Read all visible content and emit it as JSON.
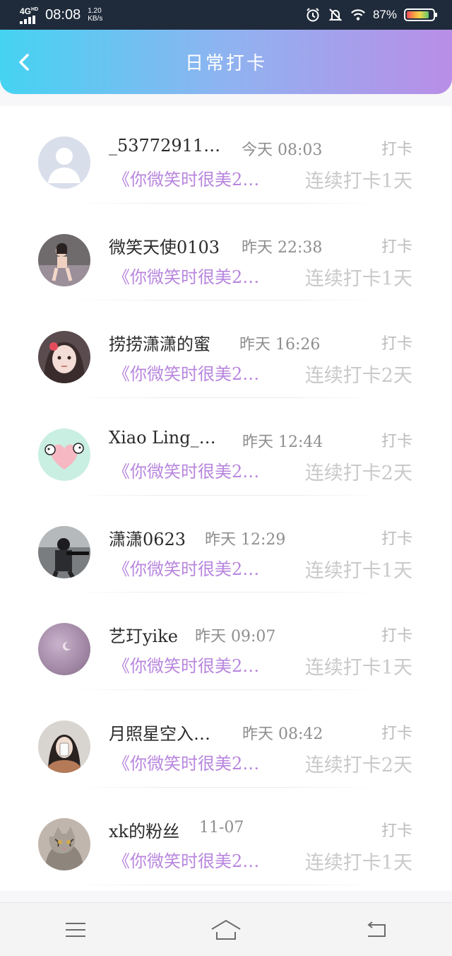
{
  "status_bar": {
    "network": "4G",
    "network_sup": "HD",
    "time": "08:08",
    "speed_value": "1.20",
    "speed_unit": "KB/s",
    "battery_percent": "87%",
    "battery_level": 0.87,
    "icons": [
      "alarm-icon",
      "mute-bell-icon",
      "wifi-icon",
      "battery-icon"
    ]
  },
  "header": {
    "title": "日常打卡",
    "back_icon": "chevron-left-icon",
    "gradient": [
      "#45d3f2",
      "#8fb3f0",
      "#b98ee6"
    ]
  },
  "colors": {
    "book_text": "#b886de",
    "streak_text": "#c9c9c9",
    "tag_text": "#bcbcbc"
  },
  "records": [
    {
      "name": "_53772911…",
      "time": "今天 08:03",
      "tag": "打卡",
      "book": "《你微笑时很美2…",
      "streak": "连续打卡1天",
      "avatar": "default-avatar"
    },
    {
      "name": "微笑天使0103",
      "time": "昨天 22:38",
      "tag": "打卡",
      "book": "《你微笑时很美2…",
      "streak": "连续打卡1天",
      "avatar": "photo-avatar"
    },
    {
      "name": "捞捞潇潇的蜜",
      "time": "昨天 16:26",
      "tag": "打卡",
      "book": "《你微笑时很美2…",
      "streak": "连续打卡2天",
      "avatar": "photo-avatar"
    },
    {
      "name": "Xiao Ling_…",
      "time": "昨天 12:44",
      "tag": "打卡",
      "book": "《你微笑时很美2…",
      "streak": "连续打卡2天",
      "avatar": "panda-heart-avatar"
    },
    {
      "name": "潇潇0623",
      "time": "昨天 12:29",
      "tag": "打卡",
      "book": "《你微笑时很美2…",
      "streak": "连续打卡1天",
      "avatar": "photo-avatar"
    },
    {
      "name": "艺玎yike",
      "time": "昨天 09:07",
      "tag": "打卡",
      "book": "《你微笑时很美2…",
      "streak": "连续打卡1天",
      "avatar": "photo-avatar"
    },
    {
      "name": "月照星空入…",
      "time": "昨天 08:42",
      "tag": "打卡",
      "book": "《你微笑时很美2…",
      "streak": "连续打卡2天",
      "avatar": "photo-avatar"
    },
    {
      "name": "xk的粉丝",
      "time": "11-07",
      "tag": "打卡",
      "book": "《你微笑时很美2…",
      "streak": "连续打卡1天",
      "avatar": "cat-avatar"
    }
  ],
  "nav_bar": {
    "buttons": [
      "menu-icon",
      "home-icon",
      "back-icon"
    ]
  }
}
